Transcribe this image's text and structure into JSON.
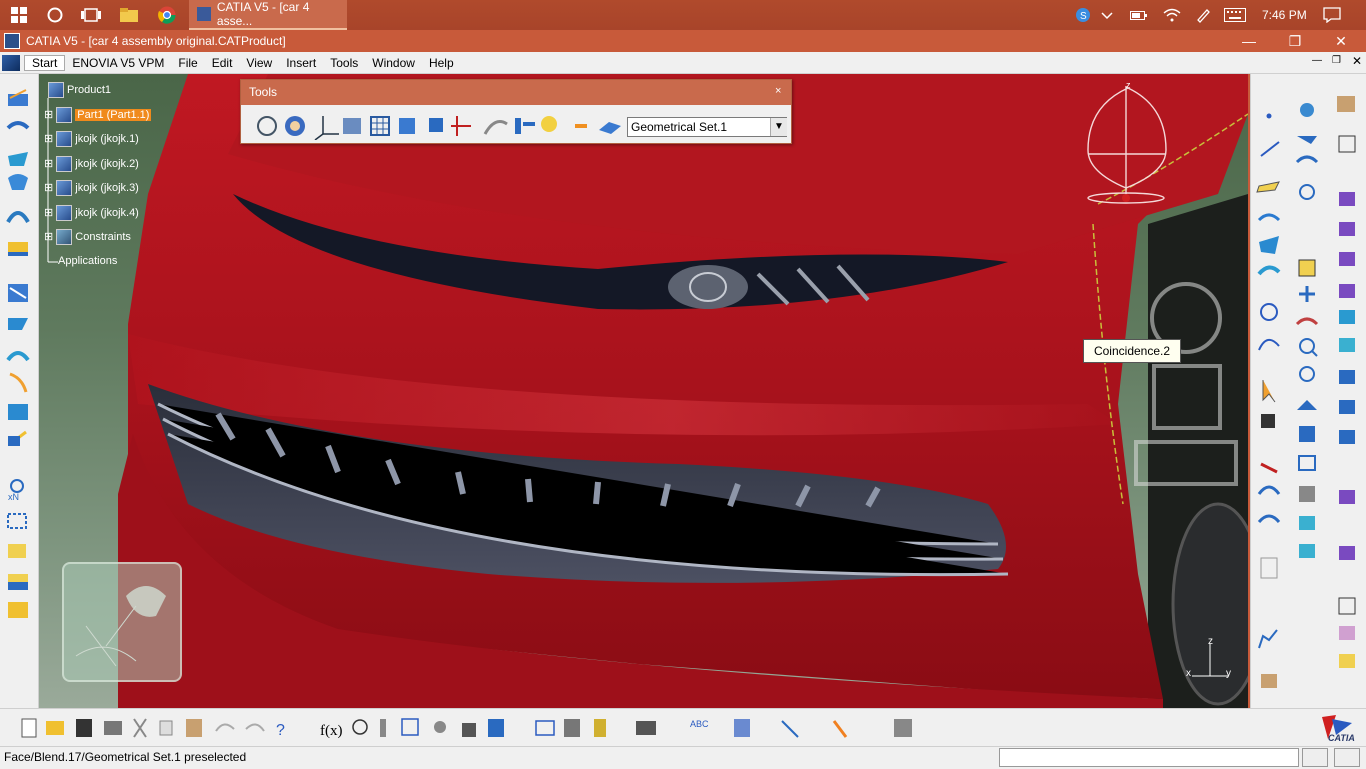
{
  "taskbar": {
    "catia_button_label": "CATIA V5 - [car 4 asse...",
    "clock": "7:46 PM"
  },
  "window": {
    "title": "CATIA V5 - [car 4 assembly original.CATProduct]"
  },
  "menu": {
    "items": [
      "Start",
      "ENOVIA V5 VPM",
      "File",
      "Edit",
      "View",
      "Insert",
      "Tools",
      "Window",
      "Help"
    ]
  },
  "tree": {
    "root": "Product1",
    "items": [
      "Part1 (Part1.1)",
      "jkojk (jkojk.1)",
      "jkojk (jkojk.2)",
      "jkojk (jkojk.3)",
      "jkojk (jkojk.4)",
      "Constraints",
      "Applications"
    ],
    "selected_index": 0
  },
  "tools_palette": {
    "title": "Tools",
    "close": "×",
    "geometrical_set": "Geometrical Set.1"
  },
  "tooltip": "Coincidence.2",
  "status": {
    "message": "Face/Blend.17/Geometrical Set.1 preselected"
  },
  "compass": {
    "z_label": "z",
    "axis_z": "z",
    "axis_x": "x",
    "axis_y": "y"
  },
  "brand": "CATIA",
  "colors": {
    "car_body": "#b0151f",
    "title_bar": "#c85a3a",
    "selected_tree_item": "#f08a1c"
  }
}
